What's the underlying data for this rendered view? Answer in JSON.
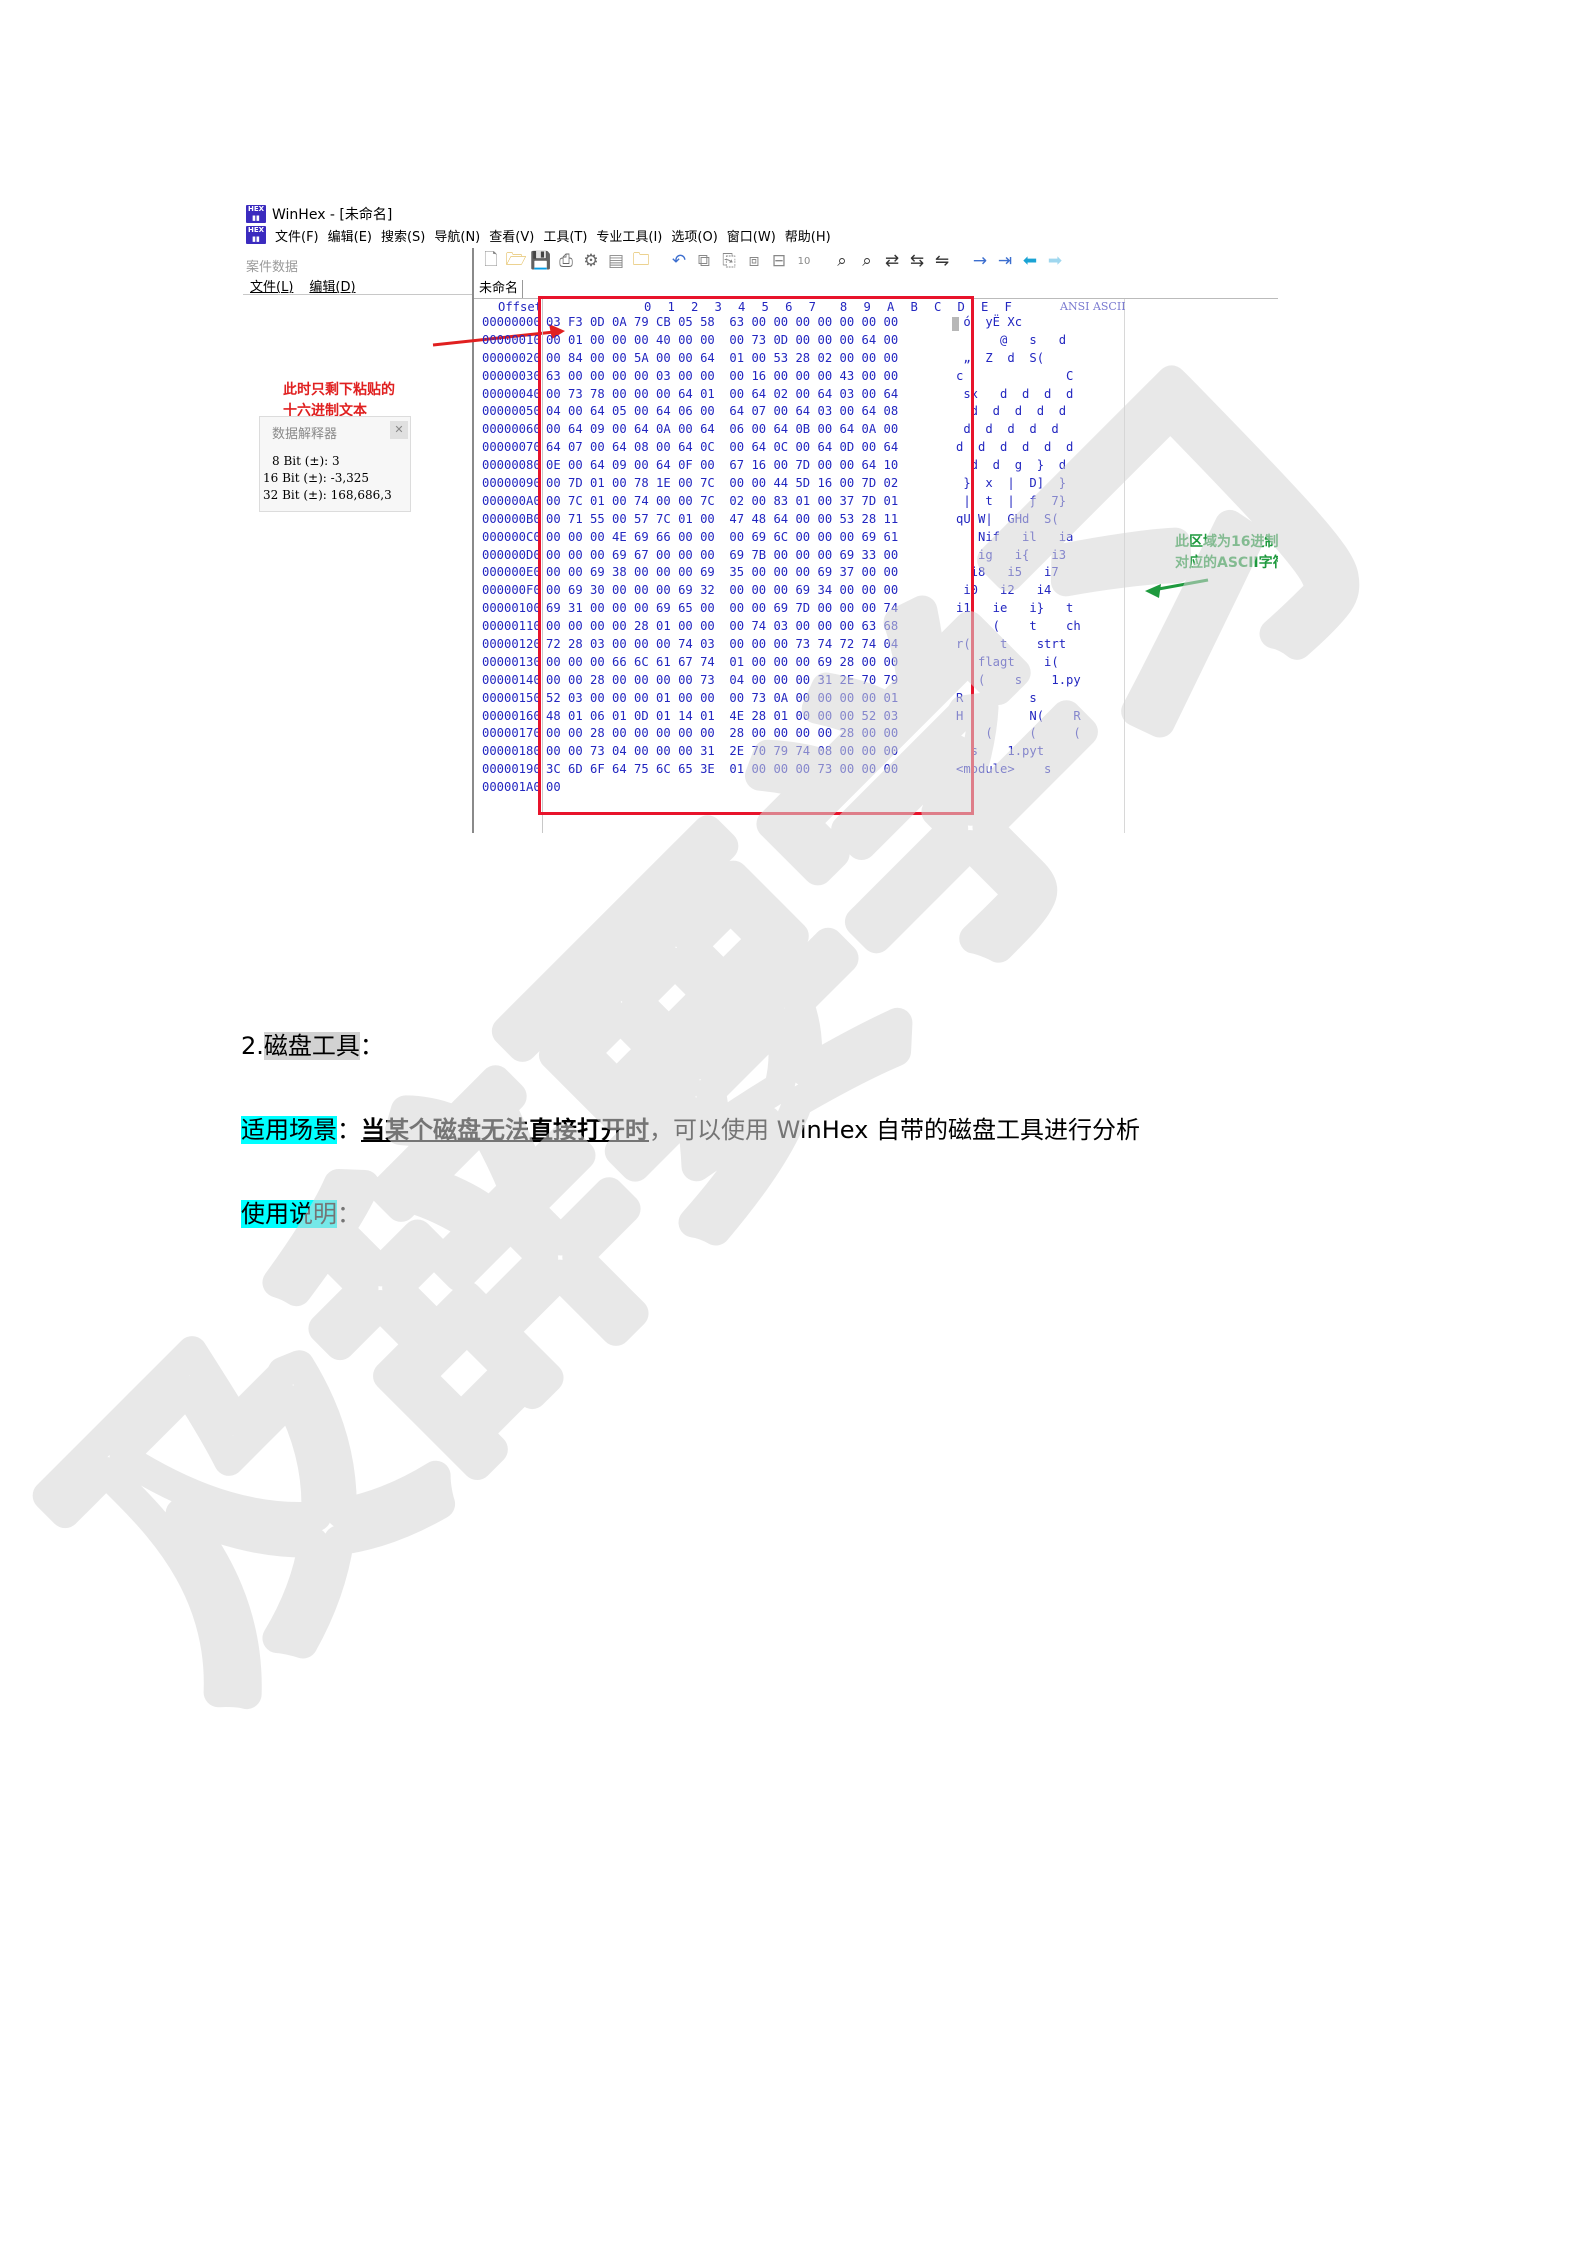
{
  "screenshot": {
    "title": "WinHex - [未命名]",
    "menu": [
      "文件(F)",
      "编辑(E)",
      "搜索(S)",
      "导航(N)",
      "查看(V)",
      "工具(T)",
      "专业工具(I)",
      "选项(O)",
      "窗口(W)",
      "帮助(H)"
    ],
    "case_panel_title": "案件数据",
    "case_menu": [
      "文件(L)",
      "编辑(D)"
    ],
    "interpreter": {
      "title": "数据解释器",
      "rows": [
        "8 Bit (±): 3",
        "16 Bit (±): -3,325",
        "32 Bit (±): 168,686,3"
      ]
    },
    "tab_label": "未命名",
    "hex_header": {
      "offset": "Offset",
      "columns": "0  1  2  3  4  5  6  7   8  9  A  B  C  D  E  F",
      "ascii": "ANSI ASCII"
    },
    "offsets": [
      "00000000",
      "00000010",
      "00000020",
      "00000030",
      "00000040",
      "00000050",
      "00000060",
      "00000070",
      "00000080",
      "00000090",
      "000000A0",
      "000000B0",
      "000000C0",
      "000000D0",
      "000000E0",
      "000000F0",
      "00000100",
      "00000110",
      "00000120",
      "00000130",
      "00000140",
      "00000150",
      "00000160",
      "00000170",
      "00000180",
      "00000190",
      "000001A0"
    ],
    "hex_rows": [
      "03 F3 0D 0A 79 CB 05 58  63 00 00 00 00 00 00 00",
      "00 01 00 00 00 40 00 00  00 73 0D 00 00 00 64 00",
      "00 84 00 00 5A 00 00 64  01 00 53 28 02 00 00 00",
      "63 00 00 00 00 03 00 00  00 16 00 00 00 43 00 00",
      "00 73 78 00 00 00 64 01  00 64 02 00 64 03 00 64",
      "04 00 64 05 00 64 06 00  64 07 00 64 03 00 64 08",
      "00 64 09 00 64 0A 00 64  06 00 64 0B 00 64 0A 00",
      "64 07 00 64 08 00 64 0C  00 64 0C 00 64 0D 00 64",
      "0E 00 64 09 00 64 0F 00  67 16 00 7D 00 00 64 10",
      "00 7D 01 00 78 1E 00 7C  00 00 44 5D 16 00 7D 02",
      "00 7C 01 00 74 00 00 7C  02 00 83 01 00 37 7D 01",
      "00 71 55 00 57 7C 01 00  47 48 64 00 00 53 28 11",
      "00 00 00 4E 69 66 00 00  00 69 6C 00 00 00 69 61",
      "00 00 00 69 67 00 00 00  69 7B 00 00 00 69 33 00",
      "00 00 69 38 00 00 00 69  35 00 00 00 69 37 00 00",
      "00 69 30 00 00 00 69 32  00 00 00 69 34 00 00 00",
      "69 31 00 00 00 69 65 00  00 00 69 7D 00 00 00 74",
      "00 00 00 00 28 01 00 00  00 74 03 00 00 00 63 68",
      "72 28 03 00 00 00 74 03  00 00 00 73 74 72 74 04",
      "00 00 00 66 6C 61 67 74  01 00 00 00 69 28 00 00",
      "00 00 28 00 00 00 00 73  04 00 00 00 31 2E 70 79",
      "52 03 00 00 00 01 00 00  00 73 0A 00 00 00 00 01",
      "48 01 06 01 0D 01 14 01  4E 28 01 00 00 00 52 03",
      "00 00 28 00 00 00 00 00  28 00 00 00 00 28 00 00",
      "00 00 73 04 00 00 00 31  2E 70 79 74 08 00 00 00",
      "3C 6D 6F 64 75 6C 65 3E  01 00 00 00 73 00 00 00",
      "00"
    ],
    "ascii_rows": [
      " ó  yË Xc",
      "      @   s   d",
      " „  Z  d  S(",
      "c              C",
      " sx   d  d  d  d",
      "  d  d  d  d  d",
      " d  d  d  d  d",
      "d  d  d  d  d  d",
      "  d  d  g  }  d",
      " }  x  |  D]  }",
      " |  t  |  ƒ  7}",
      "qU W|  GHd  S(",
      "   Nif   il   ia",
      "   ig   i{   i3",
      "  i8   i5   i7",
      " i0   i2   i4",
      "i1   ie   i}   t",
      "     (    t    ch",
      "r(    t    strt",
      "   flagt    i(",
      "   (    s    1.py",
      "R         s",
      "H         N(    R",
      "    (     (     (",
      "  s    1.pyt",
      "<module>    s",
      ""
    ],
    "annotation_left": [
      "此时只剩下粘贴的",
      "十六进制文本"
    ],
    "annotation_right": [
      "此区域为16进制文本",
      "对应的ASCII字符"
    ]
  },
  "doc": {
    "section_number": "2.",
    "section_title": "磁盘工具",
    "section_colon": "：",
    "scenario_label": "适用场景",
    "scenario_colon": "：",
    "scenario_emphasis": "当某个磁盘无法直接打开时",
    "scenario_rest_1": "，可以使用 ",
    "scenario_winhex": "WinHex",
    "scenario_rest_2": " 自带的磁盘工具进行分析",
    "usage_label": "使用说明",
    "usage_colon": "："
  },
  "watermark_text": "及辞要学习",
  "colors": {
    "hex_text": "#2226c0",
    "red_box": "#e8132b",
    "anno_red": "#e02020",
    "anno_green": "#1e9a3e",
    "highlight": "#00ffff"
  }
}
